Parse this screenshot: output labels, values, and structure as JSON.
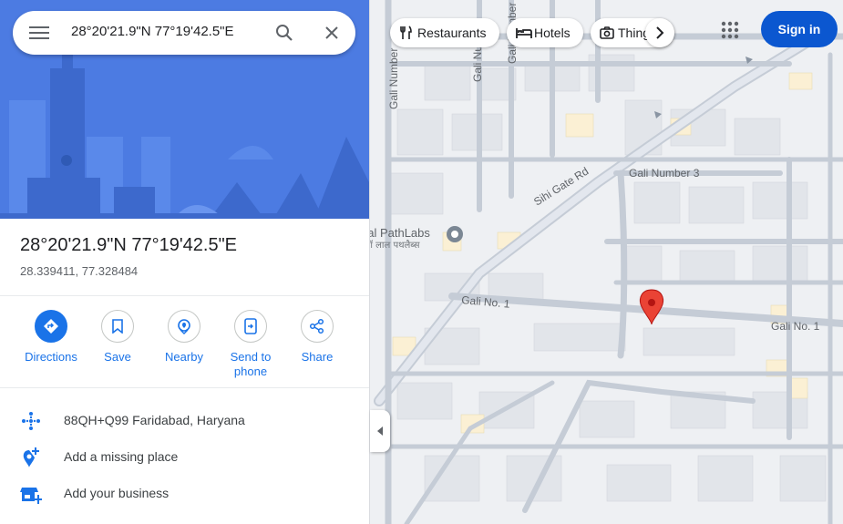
{
  "search": {
    "query": "28°20'21.9\"N 77°19'42.5\"E"
  },
  "place": {
    "title": "28°20'21.9\"N 77°19'42.5\"E",
    "decimal_coords": "28.339411, 77.328484"
  },
  "actions": [
    {
      "label": "Directions",
      "icon": "directions-icon"
    },
    {
      "label": "Save",
      "icon": "bookmark-icon"
    },
    {
      "label": "Nearby",
      "icon": "nearby-icon"
    },
    {
      "label": "Send to phone",
      "icon": "send-to-phone-icon"
    },
    {
      "label": "Share",
      "icon": "share-icon"
    }
  ],
  "info": [
    {
      "text": "88QH+Q99 Faridabad, Haryana",
      "icon": "plus-code-icon"
    },
    {
      "text": "Add a missing place",
      "icon": "add-place-icon"
    },
    {
      "text": "Add your business",
      "icon": "add-business-icon"
    }
  ],
  "map": {
    "chips": [
      {
        "label": "Restaurants",
        "icon": "restaurant-icon"
      },
      {
        "label": "Hotels",
        "icon": "hotel-icon"
      },
      {
        "label": "Things to do",
        "icon": "camera-icon"
      }
    ],
    "signin_label": "Sign in",
    "road_labels": {
      "sihi_gate": "Sihi Gate Rd",
      "gali3": "Gali Number 3",
      "gali1_left": "Gali No. 1",
      "gali1_right": "Gali No. 1",
      "gali_number_vertical": "Gali Number",
      "gali_vertical_2": "Gali Number",
      "gali_vertical_3": "Gali Number"
    },
    "poi": {
      "name": "Lal PathLabs",
      "local_name": "डॉ लाल पथलैब्स"
    },
    "colors": {
      "accent": "#1a73e8",
      "signin": "#0b57d0",
      "pin": "#ea4335"
    }
  }
}
